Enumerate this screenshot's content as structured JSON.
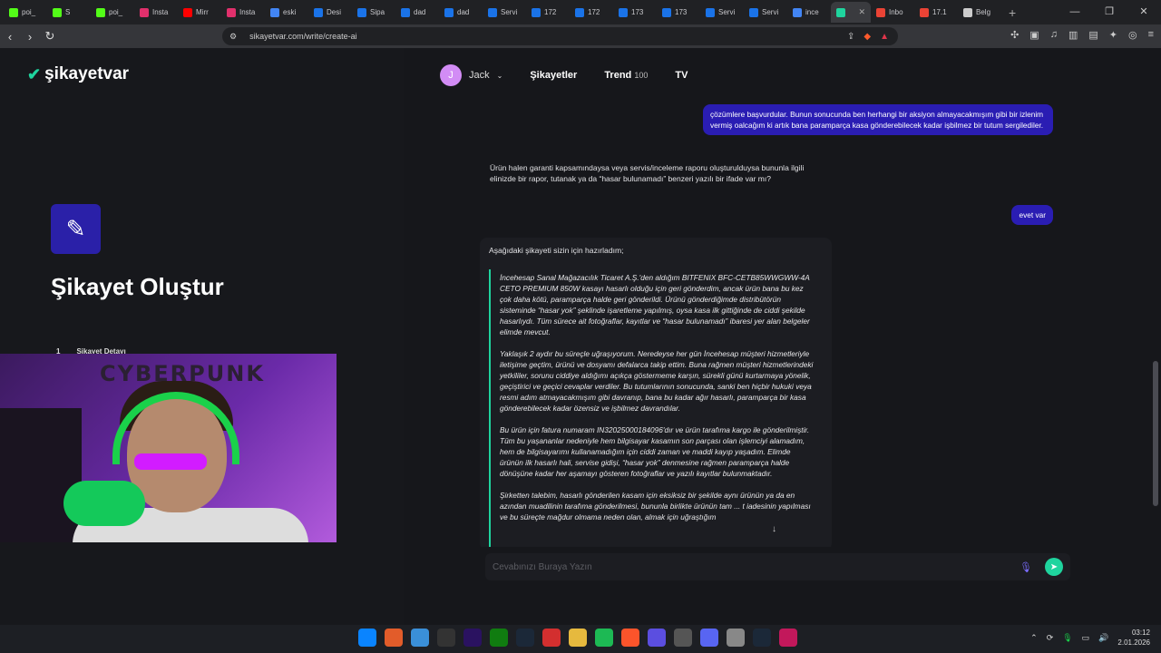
{
  "tabs": [
    {
      "label": "poi_",
      "color": "#53fc18"
    },
    {
      "label": "S",
      "color": "#53fc18"
    },
    {
      "label": "poi_",
      "color": "#53fc18"
    },
    {
      "label": "Insta",
      "color": "#e1306c"
    },
    {
      "label": "Mirr",
      "color": "#ff0000"
    },
    {
      "label": "Insta",
      "color": "#e1306c"
    },
    {
      "label": "eski",
      "color": "#4285f4"
    },
    {
      "label": "Desi",
      "color": "#1a73e8"
    },
    {
      "label": "Sipa",
      "color": "#1a73e8"
    },
    {
      "label": "dad",
      "color": "#1a73e8"
    },
    {
      "label": "dad",
      "color": "#1a73e8"
    },
    {
      "label": "Servi",
      "color": "#1a73e8"
    },
    {
      "label": "172",
      "color": "#1a73e8"
    },
    {
      "label": "172",
      "color": "#1a73e8"
    },
    {
      "label": "173",
      "color": "#1a73e8"
    },
    {
      "label": "173",
      "color": "#1a73e8"
    },
    {
      "label": "Servi",
      "color": "#1a73e8"
    },
    {
      "label": "Servi",
      "color": "#1a73e8"
    },
    {
      "label": "ince",
      "color": "#4285f4"
    },
    {
      "label": "",
      "color": "#1fd49e",
      "active": true
    },
    {
      "label": "Inbo",
      "color": "#ea4335"
    },
    {
      "label": "17.1",
      "color": "#ea4335"
    },
    {
      "label": "Belg",
      "color": "#cccccc"
    }
  ],
  "browser": {
    "url": "sikayetvar.com/write/create-ai"
  },
  "site": {
    "logo_text": "şikayetvar",
    "page_title": "Şikayet Oluştur",
    "step_number": "1",
    "step_label": "Şikayet Detayı"
  },
  "nav": {
    "user_initial": "J",
    "user_name": "Jack",
    "complaints": "Şikayetler",
    "trend": "Trend",
    "trend_count": "100",
    "tv": "TV"
  },
  "chat": {
    "user_msg_1": "çözümlere başvurdular. Bunun sonucunda ben herhangi bir aksiyon almayacakmışım gibi bir izlenim vermiş oalcağım ki artık bana paramparça kasa gönderebilecek kadar işbilmez bir tutum sergilediler.",
    "ai_msg_1": "Ürün halen garanti kapsamındaysa veya servis/inceleme raporu oluşturulduysa bununla ilgili elinizde bir rapor, tutanak ya da “hasar bulunamadı” benzeri yazılı bir ifade var mı?",
    "user_msg_2": "evet var",
    "ai_intro": "Aşağıdaki şikayeti sizin için hazırladım;",
    "draft_p1": "İncehesap Sanal Mağazacılık Ticaret A.Ş.'den aldığım BITFENIX BFC-CETB85WWGWW-4A CETO PREMIUM 850W kasayı hasarlı olduğu için geri gönderdim, ancak ürün bana bu kez çok daha kötü, paramparça halde geri gönderildi. Ürünü gönderdiğimde distribütörün sisteminde “hasar yok” şeklinde işaretleme yapılmış, oysa kasa ilk gittiğinde de ciddi şekilde hasarlıydı. Tüm sürece ait fotoğraflar, kayıtlar ve “hasar bulunamadı” ibaresi yer alan belgeler elimde mevcut.",
    "draft_p2": "Yaklaşık 2 aydır bu süreçle uğraşıyorum. Neredeyse her gün İncehesap müşteri hizmetleriyle iletişime geçtim, ürünü ve dosyamı defalarca takip ettim. Buna rağmen müşteri hizmetlerindeki yetkililer, sorunu ciddiye aldığımı açıkça göstermeme karşın, sürekli günü kurtarmaya yönelik, geçiştirici ve geçici cevaplar verdiler. Bu tutumlarının sonucunda, sanki ben hiçbir hukuki veya resmi adım atmayacakmışım gibi davranıp, bana bu kadar ağır hasarlı, paramparça bir kasa gönderebilecek kadar özensiz ve işbilmez davrandılar.",
    "draft_p3": "Bu ürün için fatura numaram IN32025000184096'dır ve ürün tarafıma kargo ile gönderilmiştir. Tüm bu yaşananlar nedeniyle hem bilgisayar kasamın son parçası olan işlemciyi alamadım, hem de bilgisayarımı kullanamadığım için ciddi zaman ve maddi kayıp yaşadım. Elimde ürünün ilk hasarlı hali, servise gidişi, “hasar yok” denmesine rağmen paramparça halde dönüşüne kadar her aşamayı gösteren fotoğraflar ve yazılı kayıtlar bulunmaktadır.",
    "draft_p4": "Şirketten talebim, hasarlı gönderilen kasam için eksiksiz bir şekilde aynı ürünün ya da en azından muadilinin tarafıma gönderilmesi, bununla birlikte ürünün tam ... t iadesinin yapılması ve bu süreçte mağdur olmama neden olan, almak için uğraştığım",
    "input_placeholder": "Cevabınızı Buraya Yazın"
  },
  "taskbar": {
    "icons": [
      "windows-start",
      "app",
      "remote-desktop",
      "epic-games",
      "premiere-pro",
      "xbox",
      "steam",
      "app",
      "file-explorer",
      "spotify",
      "brave",
      "app",
      "discord-alt",
      "discord",
      "settings",
      "steam",
      "app"
    ],
    "time": "03:12",
    "date": "2.01.2026"
  }
}
